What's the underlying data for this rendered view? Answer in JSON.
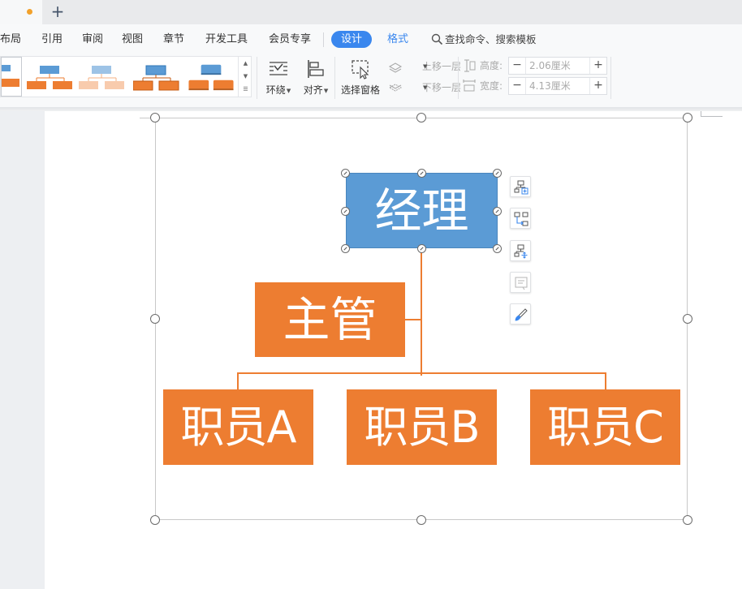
{
  "tabs": {
    "new_tab_symbol": "+"
  },
  "menu": {
    "items": [
      "布局",
      "引用",
      "审阅",
      "视图",
      "章节",
      "开发工具",
      "会员专享"
    ],
    "design_tab": "设计",
    "format_tab": "格式",
    "search_placeholder": "查找命令、搜索模板"
  },
  "ribbon": {
    "wrap_label": "环绕",
    "align_label": "对齐",
    "selection_pane_label": "选择窗格",
    "bring_forward_label": "上移一层",
    "send_backward_label": "下移一层",
    "height_label": "高度:",
    "height_value": "2.06厘米",
    "width_label": "宽度:",
    "width_value": "4.13厘米",
    "minus": "−",
    "plus": "+"
  },
  "diagram": {
    "manager": "经理",
    "supervisor": "主管",
    "staff": [
      "职员A",
      "职员B",
      "职员C"
    ]
  },
  "colors": {
    "accent_blue": "#3a87ee",
    "node_blue": "#5b9bd5",
    "node_orange": "#ed7d31"
  },
  "icons": [
    "add-shape-icon",
    "change-layout-icon",
    "layout-options-icon",
    "text-pane-icon",
    "format-brush-icon",
    "search-icon"
  ]
}
